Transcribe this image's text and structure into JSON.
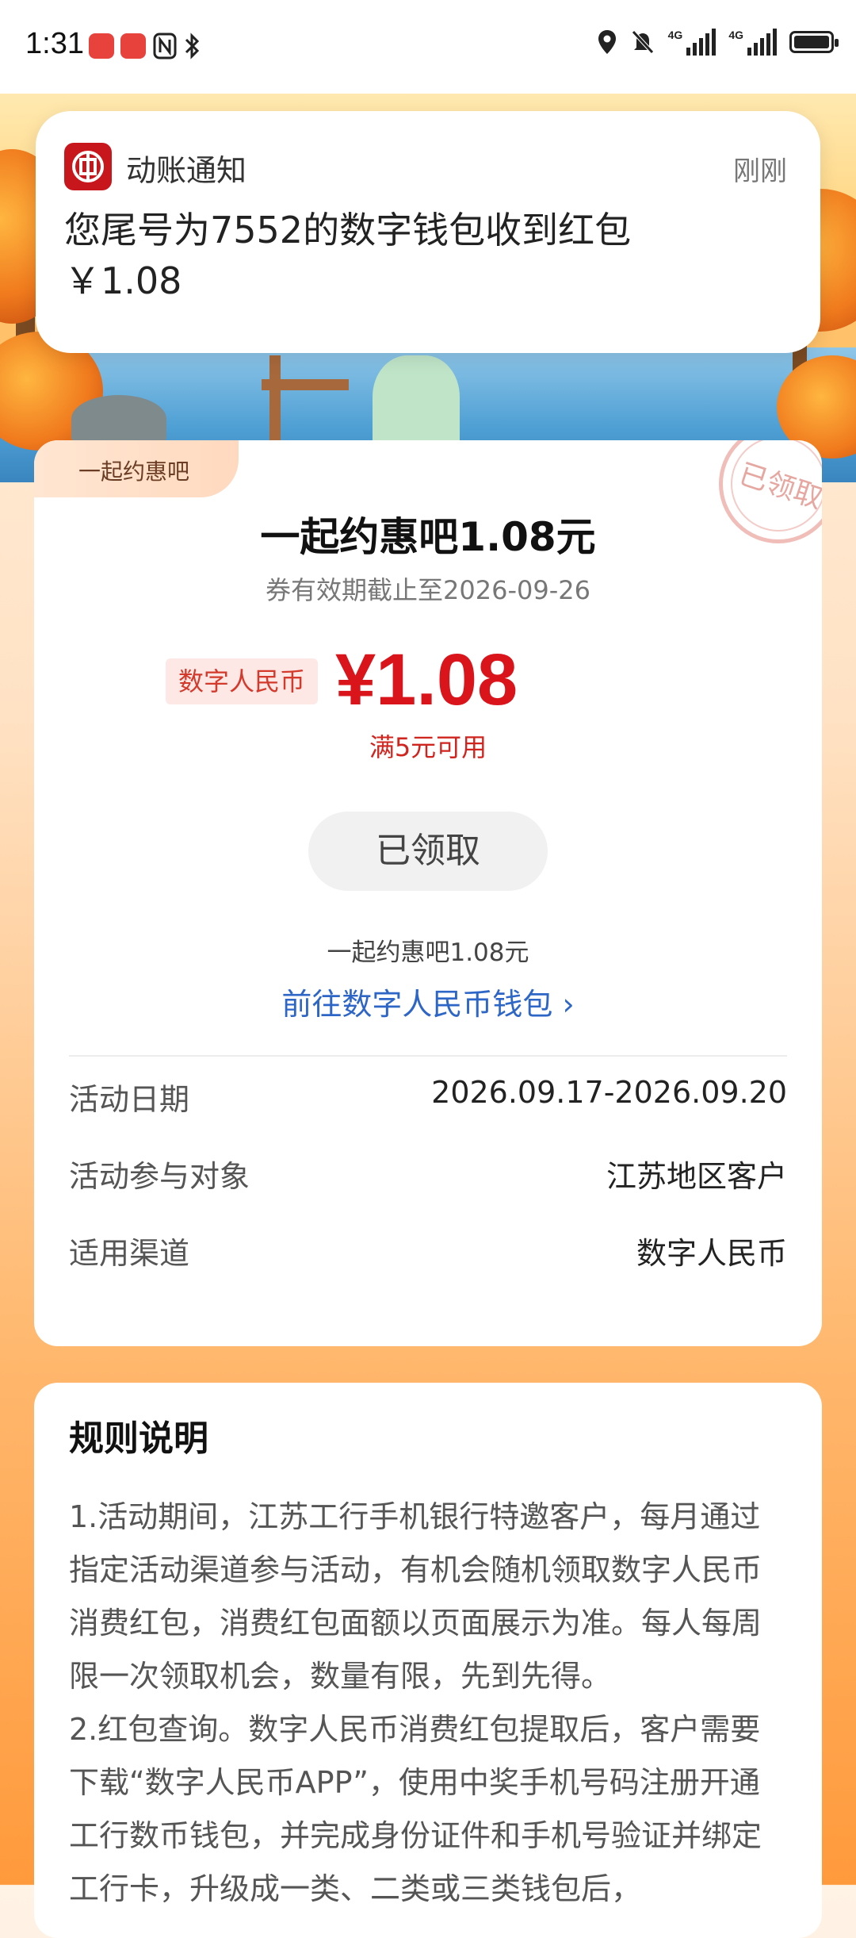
{
  "status_bar": {
    "time": "1:31",
    "network_1": "4G",
    "network_2": "4G",
    "icons": [
      "huawei-app-icon",
      "huawei-app-icon",
      "nfc-icon",
      "bluetooth-icon",
      "location-icon",
      "mute-icon",
      "signal-icon",
      "signal-icon",
      "battery-icon"
    ]
  },
  "notification": {
    "app_name": "动账通知",
    "time": "刚刚",
    "line1": "您尾号为7552的数字钱包收到红包",
    "line2": "￥1.08"
  },
  "coupon": {
    "tag": "一起约惠吧",
    "stamp": "已领取",
    "title": "一起约惠吧1.08元",
    "valid_until": "券有效期截止至2026-09-26",
    "currency_badge": "数字人民币",
    "amount": "¥1.08",
    "min_spend": "满5元可用",
    "claim_button": "已领取",
    "subtitle": "一起约惠吧1.08元",
    "link": "前往数字人民币钱包 ›"
  },
  "details": [
    {
      "label": "活动日期",
      "value": "2026.09.17-2026.09.20"
    },
    {
      "label": "活动参与对象",
      "value": "江苏地区客户"
    },
    {
      "label": "适用渠道",
      "value": "数字人民币"
    }
  ],
  "rules": {
    "title": "规则说明",
    "p1": "1.活动期间，江苏工行手机银行特邀客户，每月通过指定活动渠道参与活动，有机会随机领取数字人民币消费红包，消费红包面额以页面展示为准。每人每周限一次领取机会，数量有限，先到先得。",
    "p2": "2.红包查询。数字人民币消费红包提取后，客户需要下载“数字人民币APP”，使用中奖手机号码注册开通工行数币钱包，并完成身份证件和手机号验证并绑定工行卡，升级成一类、二类或三类钱包后，"
  },
  "colors": {
    "accent_red": "#d9141b",
    "link_blue": "#2d66c7",
    "icbc_red": "#c8161d"
  }
}
